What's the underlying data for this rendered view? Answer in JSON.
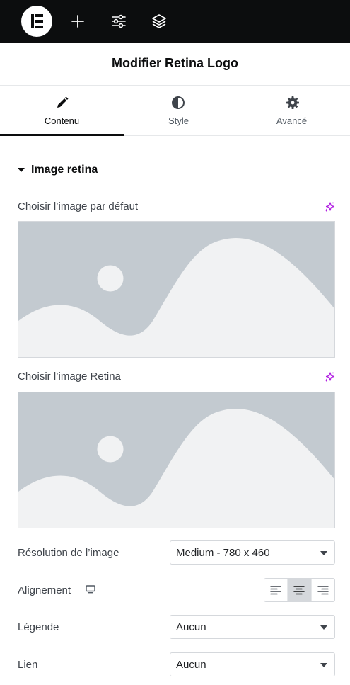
{
  "header": {
    "title": "Modifier Retina Logo"
  },
  "tabs": [
    {
      "label": "Contenu",
      "icon": "pencil-icon",
      "active": true
    },
    {
      "label": "Style",
      "icon": "half-circle-icon",
      "active": false
    },
    {
      "label": "Avancé",
      "icon": "gear-icon",
      "active": false
    }
  ],
  "section": {
    "title": "Image retina"
  },
  "controls": {
    "default_image_label": "Choisir l’image par défaut",
    "retina_image_label": "Choisir l’image Retina",
    "resolution": {
      "label": "Résolution de l’image",
      "value": "Medium - 780 x 460"
    },
    "alignment": {
      "label": "Alignement",
      "options": [
        "left",
        "center",
        "right"
      ],
      "selected": "center"
    },
    "caption": {
      "label": "Légende",
      "value": "Aucun"
    },
    "link": {
      "label": "Lien",
      "value": "Aucun"
    }
  },
  "colors": {
    "topbar": "#0c0d0e",
    "ai_accent": "#b01de2",
    "placeholder_bg": "#c3cad0",
    "placeholder_fg": "#f1f2f3"
  }
}
